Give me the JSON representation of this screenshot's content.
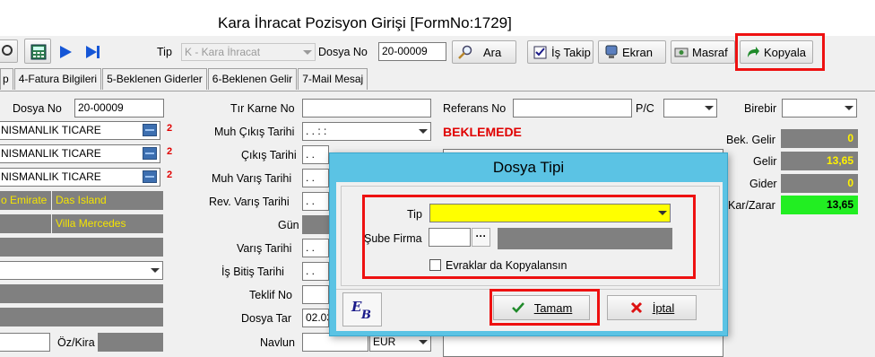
{
  "window": {
    "title": "Kara İhracat Pozisyon Girişi [FormNo:1729]"
  },
  "toolbar": {
    "tip_label": "Tip",
    "tip_value": "K - Kara  İhracat",
    "dosya_no_label": "Dosya No",
    "dosya_no_value": "20-00009",
    "ara_label": "Ara",
    "is_takip_label": "İş Takip",
    "ekran_label": "Ekran",
    "masraf_label": "Masraf",
    "kopyala_label": "Kopyala"
  },
  "tabs": [
    "p",
    "4-Fatura Bilgileri",
    "5-Beklenen Giderler",
    "6-Beklenen Gelir",
    "7-Mail Mesaj"
  ],
  "form": {
    "dosya_no_label": "Dosya No",
    "dosya_no_value": "20-00009",
    "party_rows": [
      {
        "value": "NISMANLIK TICARE",
        "badge": "2"
      },
      {
        "value": "NISMANLIK TICARE",
        "badge": "2"
      },
      {
        "value": "NISMANLIK TICARE",
        "badge": "2"
      }
    ],
    "location_left": "o Emirate",
    "location_right": "Das Island",
    "villa": "Villa Mercedes",
    "oz_kira_label": "Öz/Kira",
    "mid_labels": {
      "tir_karne_no": "Tır Karne No",
      "muh_cikis_tarihi": "Muh Çıkış Tarihi",
      "cikis_tarihi": "Çıkış Tarihi",
      "muh_varis_tarihi": "Muh Varış Tarihi",
      "rev_varis_tarihi": "Rev. Varış Tarihi",
      "gun": "Gün",
      "varis_tarihi": "Varış Tarihi",
      "is_bitis_tarihi": "İş Bitiş Tarihi",
      "teklif_no": "Teklif No",
      "dosya_tar": "Dosya Tar",
      "navlun": "Navlun"
    },
    "date_placeholder": " .  .      :  :",
    "date_short": " .  .",
    "dosya_tar_value": "02.03",
    "currency": "EUR",
    "referans_no_label": "Referans No",
    "pc_label": "P/C",
    "status": "BEKLEMEDE",
    "birebir_label": "Birebir",
    "summary": [
      {
        "label": "Bek. Gelir",
        "value": "0",
        "color": "#808080"
      },
      {
        "label": "Gelir",
        "value": "13,65",
        "color": "#808080"
      },
      {
        "label": "Gider",
        "value": "0",
        "color": "#808080"
      },
      {
        "label": "Kar/Zarar",
        "value": "13,65",
        "color": "#22ee22"
      }
    ]
  },
  "dialog": {
    "title": "Dosya Tipi",
    "tip_label": "Tip",
    "tip_value": "",
    "sube_firma_label": "Şube Firma",
    "sube_firma_dots": "···",
    "evraklar_label": "Evraklar da Kopyalansın",
    "tamam_label": "Tamam",
    "iptal_label": "İptal",
    "logo_text": "EB"
  },
  "colors": {
    "highlight_red": "#ee1111",
    "dialog_title_bg": "#5bc3e4",
    "tip_field_bg": "#ffff00",
    "status_red": "#e00000",
    "profit_green": "#22ee22"
  }
}
